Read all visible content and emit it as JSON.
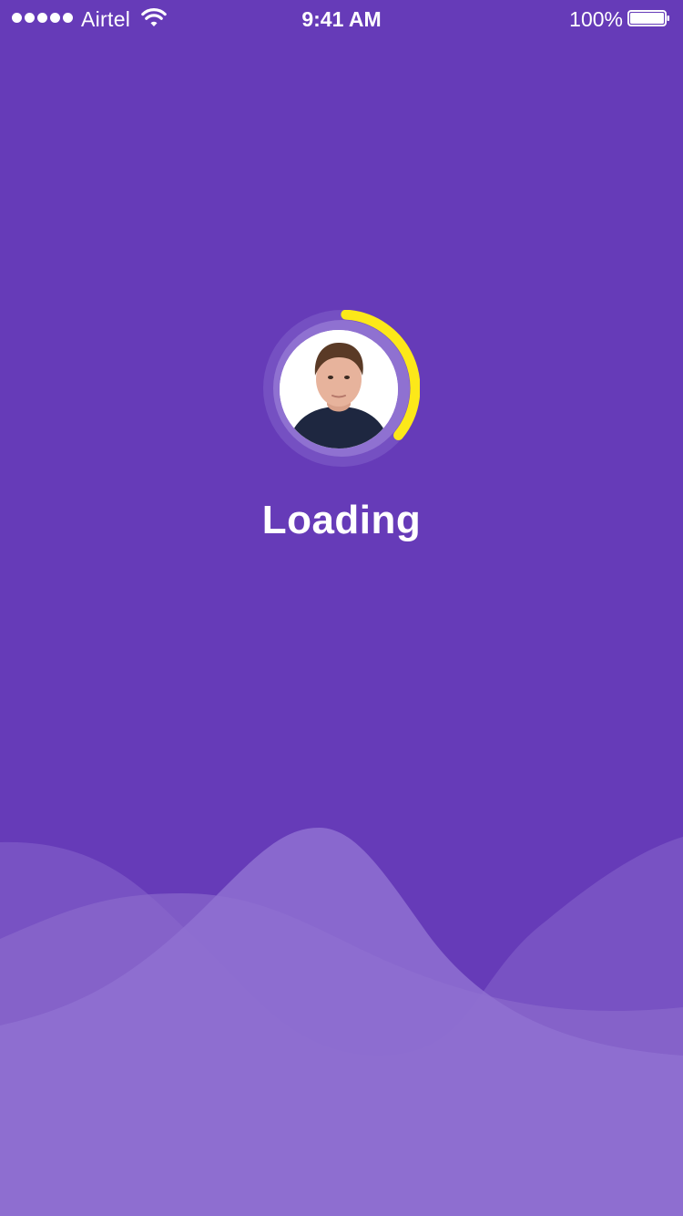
{
  "status_bar": {
    "signal_bars": 5,
    "carrier": "Airtel",
    "time": "9:41 AM",
    "battery": "100%"
  },
  "loader": {
    "progress": 0.35,
    "label": "Loading"
  },
  "colors": {
    "background": "#663BB8",
    "ring_outer": "#7550C2",
    "ring_inner": "#8F71D1",
    "progress": "#FCE819",
    "text": "#FFFFFF"
  },
  "icons": {
    "wifi": "wifi-icon",
    "battery": "battery-icon",
    "avatar": "user-avatar"
  }
}
